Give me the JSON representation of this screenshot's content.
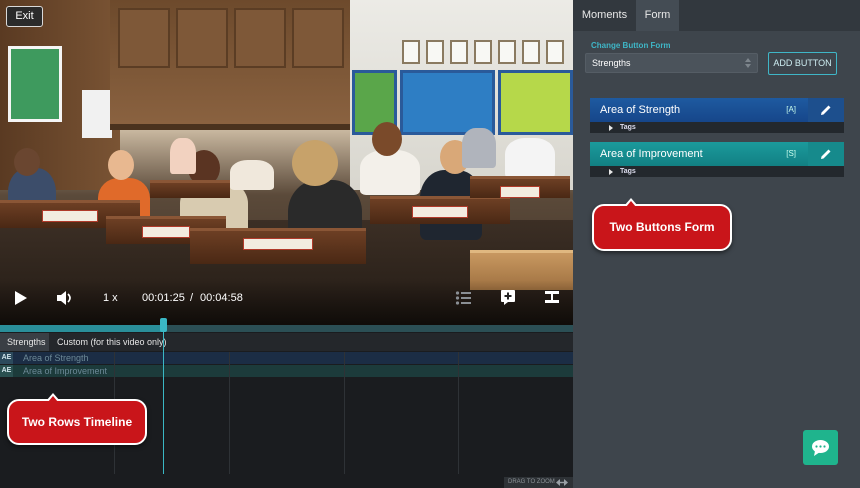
{
  "video": {
    "exit_label": "Exit",
    "speed": "1 x",
    "time_current": "00:01:25",
    "time_separator": "/",
    "time_total": "00:04:58",
    "progress": 0.285
  },
  "timeline": {
    "tabs": [
      "Strengths",
      "Custom (for this video only)"
    ],
    "rows": [
      {
        "badge": "AE",
        "label": "Area of Strength"
      },
      {
        "badge": "AE",
        "label": "Area of Improvement"
      }
    ],
    "zoom_label": "DRAG TO ZOOM"
  },
  "callouts": {
    "timeline": "Two Rows Timeline",
    "form": "Two Buttons Form"
  },
  "panel": {
    "tabs": [
      "Moments",
      "Form"
    ],
    "active_tab": "Form",
    "change_form_label": "Change Button Form",
    "selected_form": "Strengths",
    "add_button_label": "ADD BUTTON",
    "buttons": [
      {
        "label": "Area of Strength",
        "shortcut": "[A]",
        "tags_label": "Tags",
        "color": "#1e5aa0"
      },
      {
        "label": "Area of Improvement",
        "shortcut": "[S]",
        "tags_label": "Tags",
        "color": "#1b9a9c"
      }
    ]
  },
  "colors": {
    "accent": "#3fb6c7",
    "callout": "#c9151a",
    "chat": "#1fb48d"
  },
  "icons": [
    "play-icon",
    "volume-icon",
    "list-icon",
    "add-moment-icon",
    "split-icon",
    "edit-icon",
    "chat-icon",
    "zoom-arrows-icon",
    "select-arrows-icon"
  ]
}
